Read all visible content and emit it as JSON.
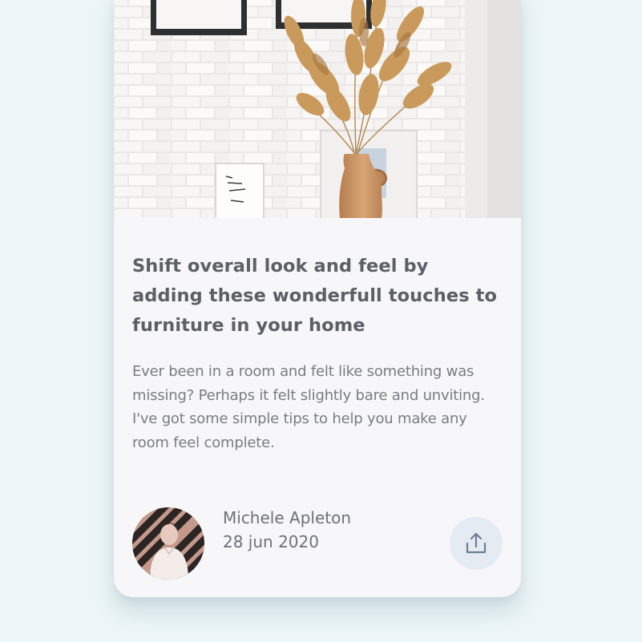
{
  "article": {
    "title": "Shift overall look and feel by adding these wonderfull touches to furniture in your home",
    "excerpt": "Ever been in a room and felt like something was missing? Perhaps it felt slightly bare and unviting. I've got some simple tips to help you make any room feel complete.",
    "hero_image": "decor-image"
  },
  "author": {
    "name": "Michele Apleton",
    "date": "28 jun 2020",
    "avatar_icon": "avatar"
  },
  "actions": {
    "share_icon": "share-icon"
  },
  "colors": {
    "page_background": "#ecf6f8",
    "card_background": "#f7f7f9",
    "title_text": "#5d5f66",
    "body_text": "#7a7c83",
    "share_button_background": "#e4ebf2",
    "share_icon": "#6f7f94"
  }
}
